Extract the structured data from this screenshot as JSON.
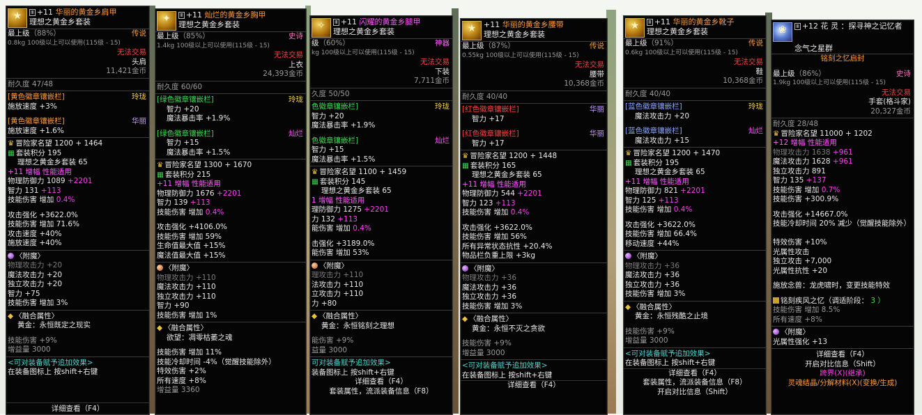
{
  "panels": [
    {
      "lv": "+11",
      "name": "华丽的黄金乡肩甲",
      "set": "理想之黄金乡套装",
      "grade_left": "最上级",
      "grade_pct": "（88%）",
      "rarity": "传说",
      "weight": "0.8kg",
      "req": "100级以上可以使用(115级 - 15)",
      "trade": "无法交易",
      "slot": "头肩",
      "price": "11,421金币",
      "durability": "耐久度 47/48",
      "slot1_name": "[黄色徽章镶嵌栏]",
      "slot1_grade": "玲珑",
      "slot1_stat": "施放速度 +3%",
      "slot2_name": "[黄色徽章镶嵌栏]",
      "slot2_grade": "华丽",
      "slot2_stat": "施放速度 +1.6%",
      "fame": "冒险家名望 1200 + 1464",
      "set_pts": "套装积分 195",
      "set_line": "理想之黄金乡套装 65",
      "amp": "+11 增幅 性能适用",
      "def": "物理防御力 1089",
      "def_plus": "+2201",
      "int": "智力 131",
      "int_plus": "+113",
      "skill": "技能伤害 增加",
      "skill_v": "0.4%",
      "e1": "攻击强化 +3622.0%",
      "e2": "技能伤害 增加 71.6%",
      "e3": "攻击速度 +40%",
      "e4": "施放速度 +40%",
      "ench": "附魔",
      "en1": "物理攻击力 +20",
      "en2": "魔法攻击力 +20",
      "en3": "独立攻击力 +20",
      "en4": "智力 +75",
      "en5": "技能伤害 增加 3%",
      "fuse": "融合属性",
      "fuse_v": "黄金：永恒既定之现实",
      "f1": "技能伤害 +9%",
      "f2": "增益量 3000",
      "tip1": "<可对装备赋予追加效果>",
      "tip2": "在装备图标上 按shift+右键",
      "bottom": "详细查看（F4）"
    },
    {
      "lv": "+11",
      "name": "灿烂的黄金乡胸甲",
      "set": "理想之黄金乡套装",
      "grade_left": "最上级",
      "grade_pct": "（85%）",
      "rarity": "史诗",
      "weight": "1.4kg",
      "req": "100级以上可以使用(115级 - 15)",
      "trade": "无法交易",
      "slot": "上衣",
      "price": "24,393金币",
      "durability": "耐久度 60/60",
      "slot1_name": "[绿色徽章镶嵌栏]",
      "slot1_grade": "玲珑",
      "slot1_a": "智力 +20",
      "slot1_b": "魔法暴击率 +1.9%",
      "slot2_name": "[绿色徽章镶嵌栏]",
      "slot2_grade": "灿烂",
      "slot2_a": "智力 +15",
      "slot2_b": "魔法暴击率 +1.5%",
      "fame": "冒险家名望 1300 + 1670",
      "set_pts": "套装积分 215",
      "amp": "+11 增幅 性能适用",
      "def": "物理防御力 1676",
      "def_plus": "+2201",
      "int": "智力 139",
      "int_plus": "+113",
      "skill": "技能伤害 增加",
      "skill_v": "0.4%",
      "e1": "攻击强化 +4106.0%",
      "e2": "技能伤害 增加 59%",
      "e3": "生命值最大值 +15%",
      "e4": "魔法值最大值 +15%",
      "ench": "附魔",
      "en1": "物理攻击力 +110",
      "en2": "魔法攻击力 +110",
      "en3": "独立攻击力 +110",
      "en4": "智力 +90",
      "en5": "技能伤害 增加 1%",
      "fuse": "融合属性",
      "fuse_v": "欲望：凋零枯萎之魂",
      "f1": "技能伤害 增加 11%",
      "f2": "技能冷却时间 -4%（觉醒技能除外）",
      "f3": "特效伤害 +2%",
      "f4": "所有速度 +8%",
      "f5": "增益量 3360"
    },
    {
      "lv": "+11",
      "name": "闪耀的黄金乡腿甲",
      "set": "理想之黄金乡套装",
      "grade_left": "级",
      "grade_pct": "（60%）",
      "rarity": "神器",
      "weight": "kg",
      "req": "100级以上可以使用(115级 - 15)",
      "trade": "无法交易",
      "slot": "下装",
      "price": "7,711金币",
      "durability": "久度 50/50",
      "slot1_name": "色徽章镶嵌栏]",
      "slot1_grade": "玲珑",
      "slot1_a": "智力 +20",
      "slot1_b": "魔法暴击率 +1.9%",
      "slot2_name": "色徽章镶嵌栏]",
      "slot2_grade": "灿烂",
      "slot2_a": "智力 +15",
      "slot2_b": "魔法暴击率 +1.5%",
      "fame": "冒险家名望 1100 + 1459",
      "set_pts": "套装积分 145",
      "set_line": "理想之黄金乡套装 65",
      "amp": "1 增幅 性能适用",
      "def": "理防御力 1275",
      "def_plus": "+2201",
      "int": "力 132",
      "int_plus": "+113",
      "skill": "能伤害 增加",
      "skill_v": "0.4%",
      "e1": "击强化 +3189.0%",
      "e2": "能伤害 增加 53%",
      "ench": "附魔",
      "en1": "理攻击力 +110",
      "en2": "法攻击力 +110",
      "en3": "立攻击力 +110",
      "en4": "力 +80",
      "fuse": "融合属性",
      "fuse_v": "黄金：永恒铭刻之理想",
      "f1": "能伤害 +9%",
      "f2": "益量 3000",
      "tip1": "可对装备赋予追加效果>",
      "tip2": "装备图标上 按shift+右键",
      "bottom": "详细查看（F4）",
      "bottom2": "套装属性，流派装备信息（F8）"
    },
    {
      "lv": "+11",
      "name": "华丽的黄金乡腰带",
      "set": "理想之黄金乡套装",
      "grade_left": "最上级",
      "grade_pct": "（87%）",
      "rarity": "传说",
      "weight": "0.55kg",
      "req": "100级以上可以使用(115级 - 15)",
      "trade": "无法交易",
      "slot": "腰带",
      "price": "10,368金币",
      "durability": "耐久度 40/40",
      "slot1_name": "[红色徽章镶嵌栏]",
      "slot1_grade": "华丽",
      "slot1_a": "智力 +17",
      "slot2_name": "[红色徽章镶嵌栏]",
      "slot2_grade": "华丽",
      "slot2_a": "智力 +17",
      "fame": "冒险家名望 1200 + 1448",
      "set_pts": "套装积分 165",
      "set_line": "理想之黄金乡套装 65",
      "amp": "+11 增幅 性能适用",
      "def": "物理防御力 544",
      "def_plus": "+2201",
      "int": "智力 123",
      "int_plus": "+113",
      "skill": "技能伤害 增加",
      "skill_v": "0.4%",
      "e1": "攻击强化 +3622.0%",
      "e2": "技能伤害 增加 56%",
      "e3": "所有异常状态抗性 +20.4%",
      "e4": "物品栏负重上限 +3kg",
      "ench": "附魔",
      "en1": "物理攻击力 +36",
      "en2": "魔法攻击力 +36",
      "en3": "独立攻击力 +36",
      "en4": "技能伤害 增加 3%",
      "fuse": "融合属性",
      "fuse_v": "黄金：永恒不灭之贪欲",
      "f1": "技能伤害 +9%",
      "f2": "增益量 3000",
      "tip1": "<可对装备赋予追加效果>",
      "tip2": "在装备图标上 按shift+右键",
      "bottom": "详细查看（F4）"
    },
    {
      "lv": "+11",
      "name": "华丽的黄金乡靴子",
      "set": "理想之黄金乡套装",
      "grade_left": "最上级",
      "grade_pct": "（91%）",
      "rarity": "传说",
      "weight": "0.6kg",
      "req": "100级以上可以使用(115级 - 15)",
      "trade": "无法交易",
      "slot": "鞋",
      "price": "10,368金币",
      "durability": "耐久度 40/40",
      "slot1_name": "[蓝色徽章镶嵌栏]",
      "slot1_grade": "玲珑",
      "slot1_a": "魔法攻击力 +20",
      "slot2_name": "[蓝色徽章镶嵌栏]",
      "slot2_grade": "灿烂",
      "slot2_a": "魔法攻击力 +15",
      "fame": "冒险家名望 1200 + 1470",
      "set_pts": "套装积分 195",
      "set_line": "理想之黄金乡套装 65",
      "amp": "+11 增幅 性能适用",
      "def": "物理防御力 821",
      "def_plus": "+2201",
      "int": "智力 125",
      "int_plus": "+113",
      "skill": "技能伤害 增加",
      "skill_v": "0.4%",
      "e1": "攻击强化 +3622.0%",
      "e2": "技能伤害 增加 66.4%",
      "e3": "移动速度 +44%",
      "ench": "附魔",
      "en1": "物理攻击力 +36",
      "en2": "魔法攻击力 +36",
      "en3": "独立攻击力 +36",
      "en4": "技能伤害 增加 3%",
      "fuse": "融合属性",
      "fuse_v": "黄金：永恒残酷之止境",
      "f1": "技能伤害 +9%",
      "f2": "增益量 3000",
      "tip1": "<可对装备赋予追加效果>",
      "tip2": "在装备图标上 按shift+右键",
      "bottom": "详细查看（F4）",
      "bottom2": "套装属性，流派装备信息（F8）",
      "bottom3": "开启对比信息（Shift）"
    },
    {
      "lv": "+12",
      "name": "花 灵 ：探寻神之记忆者",
      "sub": "念气之星群",
      "engrave": "铭刻之忆启封",
      "grade_left": "最上级",
      "grade_pct": "（86%）",
      "rarity": "史诗",
      "weight": "1.9kg",
      "req": "100级以上可以使用(115级 - 15)",
      "trade": "无法交易",
      "slot": "手套(格斗家)",
      "price": "20,327金币",
      "durability": "耐久度 28/48",
      "fame": "冒险家名望 11000 + 1202",
      "amp": "+12 增幅 性能适用",
      "a1": "物理攻击力 1638",
      "a1p": "+961",
      "a2": "魔法攻击力 1628",
      "a2p": "+961",
      "a3": "独立攻击力 891",
      "int": "智力 135",
      "int_plus": "+137",
      "skill": "技能伤害 增加",
      "skill_v": "0.7%",
      "skill2": "技能伤害 +300.9%",
      "e1": "攻击强化 +14667.0%",
      "e2": "技能冷却时间 20% 减少（觉醒技能除外）",
      "e3": "特效伤害 +10%",
      "e4": "光属性攻击",
      "e5": "独立攻击 +7,000",
      "e6": "光属性抗性 +20",
      "passive": "施放念兽：龙虎啸时，变更技能特效",
      "engrave2": "铭刻疾风之忆（调适阶段：",
      "engrave2_v": "3 ）",
      "g1": "技能伤害 增加 8.5%",
      "g2": "所有速度 +8%",
      "ench": "附魔",
      "en1": "光属性强化 +13",
      "bottom": "详细查看（F4）",
      "bottom2": "开启对比信息（Shift）",
      "bottom3": "跨界(X)(继承)",
      "bottom4": "灵魂结晶/分解材料(X)(变换/生成)"
    }
  ]
}
